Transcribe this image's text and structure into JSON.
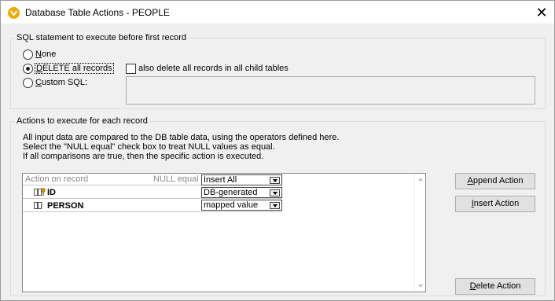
{
  "window": {
    "title": "Database Table Actions - PEOPLE",
    "close_glyph": "✕"
  },
  "sql_group": {
    "legend": "SQL statement to execute before first record",
    "options": [
      {
        "key": "N",
        "rest": "one",
        "checked": false
      },
      {
        "key": "D",
        "rest": "ELETE all records",
        "checked": true
      },
      {
        "key": "C",
        "rest": "ustom SQL:",
        "checked": false
      }
    ],
    "child_tables_checkbox": {
      "label": "also delete all records in all child tables",
      "checked": false
    },
    "custom_sql_value": ""
  },
  "actions_group": {
    "legend": "Actions to execute for each record",
    "help_lines": [
      "All input data are compared to the DB table data, using the operators defined here.",
      "Select the \"NULL equal\" check box to treat NULL values as equal.",
      "If all comparisons are true, then the specific action is executed."
    ],
    "grid": {
      "header_action": "Action on record",
      "header_null": "NULL equal",
      "header_select": "Insert All",
      "rows": [
        {
          "label": "ID",
          "icon": "key-column-icon",
          "select": "DB-generated"
        },
        {
          "label": "PERSON",
          "icon": "column-icon",
          "select": "mapped value"
        }
      ]
    },
    "buttons": {
      "append": {
        "key": "A",
        "rest": "ppend Action"
      },
      "insert": {
        "key": "I",
        "rest": "nsert Action"
      },
      "delete": {
        "key": "D",
        "rest": "elete Action"
      }
    }
  }
}
